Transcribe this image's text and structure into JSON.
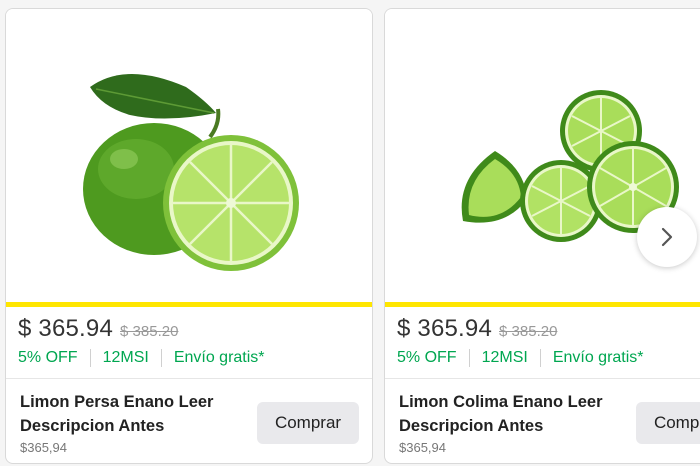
{
  "colors": {
    "promo_green": "#00a650",
    "highlight_bar": "#ffe600",
    "price_text": "#333333",
    "old_price": "#999999"
  },
  "products": [
    {
      "image_icon": "persian-lime-with-leaf-icon",
      "price_current": "$ 365.94",
      "price_old": "$ 385.20",
      "discount": "5% OFF",
      "installments": "12MSI",
      "shipping": "Envío gratis*",
      "title_line1": "Limon Persa Enano Leer",
      "title_line2": "Descripcion Antes",
      "subprice": "$365,94",
      "buy_label": "Comprar"
    },
    {
      "image_icon": "cut-limes-icon",
      "price_current": "$ 365.94",
      "price_old": "$ 385.20",
      "discount": "5% OFF",
      "installments": "12MSI",
      "shipping": "Envío gratis*",
      "title_line1": "Limon Colima Enano Leer",
      "title_line2": "Descripcion Antes",
      "subprice": "$365,94",
      "buy_label": "Comprar"
    }
  ],
  "carousel": {
    "next_icon": "chevron-right-icon"
  }
}
